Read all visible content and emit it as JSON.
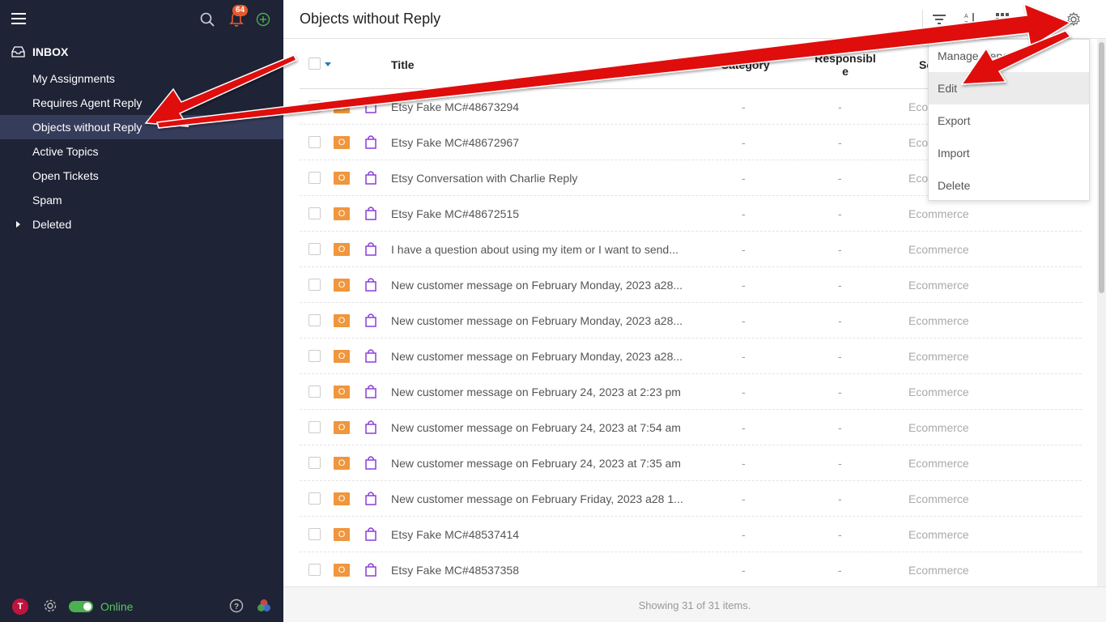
{
  "sidebar": {
    "notification_count": "64",
    "inbox_label": "INBOX",
    "items": [
      {
        "label": "My Assignments"
      },
      {
        "label": "Requires Agent Reply"
      },
      {
        "label": "Objects without Reply"
      },
      {
        "label": "Active Topics"
      },
      {
        "label": "Open Tickets"
      },
      {
        "label": "Spam"
      },
      {
        "label": "Deleted"
      }
    ],
    "avatar_letter": "T",
    "status_label": "Online"
  },
  "header": {
    "title": "Objects without Reply"
  },
  "table": {
    "columns": {
      "title": "Title",
      "category": "Category",
      "responsible": "Responsibl\ne",
      "source": "So"
    },
    "type_tag": "O",
    "rows": [
      {
        "title": "Etsy Fake MC#48673294",
        "category": "-",
        "responsible": "-",
        "source": "Ecomm"
      },
      {
        "title": "Etsy Fake MC#48672967",
        "category": "-",
        "responsible": "-",
        "source": "Ecom"
      },
      {
        "title": "Etsy Conversation with Charlie Reply",
        "category": "-",
        "responsible": "-",
        "source": "Ecom"
      },
      {
        "title": "Etsy Fake MC#48672515",
        "category": "-",
        "responsible": "-",
        "source": "Ecommerce"
      },
      {
        "title": "I have a question about using my item or I want to send...",
        "category": "-",
        "responsible": "-",
        "source": "Ecommerce"
      },
      {
        "title": "New customer message on February Monday, 2023 a28...",
        "category": "-",
        "responsible": "-",
        "source": "Ecommerce"
      },
      {
        "title": "New customer message on February Monday, 2023 a28...",
        "category": "-",
        "responsible": "-",
        "source": "Ecommerce"
      },
      {
        "title": "New customer message on February Monday, 2023 a28...",
        "category": "-",
        "responsible": "-",
        "source": "Ecommerce"
      },
      {
        "title": "New customer message on February 24, 2023 at 2:23 pm",
        "category": "-",
        "responsible": "-",
        "source": "Ecommerce"
      },
      {
        "title": "New customer message on February 24, 2023 at 7:54 am",
        "category": "-",
        "responsible": "-",
        "source": "Ecommerce"
      },
      {
        "title": "New customer message on February 24, 2023 at 7:35 am",
        "category": "-",
        "responsible": "-",
        "source": "Ecommerce"
      },
      {
        "title": "New customer message on February Friday, 2023 a28 1...",
        "category": "-",
        "responsible": "-",
        "source": "Ecommerce"
      },
      {
        "title": "Etsy Fake MC#48537414",
        "category": "-",
        "responsible": "-",
        "source": "Ecommerce"
      },
      {
        "title": "Etsy Fake MC#48537358",
        "category": "-",
        "responsible": "-",
        "source": "Ecommerce"
      }
    ]
  },
  "footer": {
    "summary": "Showing 31 of 31 items."
  },
  "dropdown": {
    "items": [
      {
        "label": "Manage Report"
      },
      {
        "label": "Edit"
      },
      {
        "label": "Export"
      },
      {
        "label": "Import"
      },
      {
        "label": "Delete"
      }
    ]
  },
  "colors": {
    "sidebar_bg": "#1e2336",
    "sidebar_active": "#363d5b",
    "tag_orange": "#f0963c",
    "bag_purple": "#8a3fd8",
    "online_green": "#5cc560",
    "annotation_red": "#e01010"
  }
}
